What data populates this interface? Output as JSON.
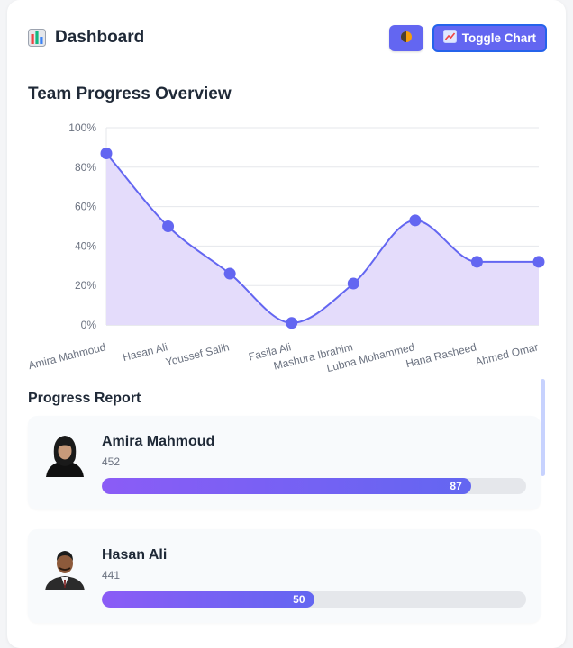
{
  "header": {
    "title": "Dashboard",
    "logo_icon": "bar-chart-icon",
    "theme_icon": "contrast-icon",
    "toggle_label": "Toggle Chart",
    "toggle_icon": "line-chart-icon"
  },
  "chart": {
    "title": "Team Progress Overview",
    "accent": "#6366f1",
    "fill": "#e4dcfb"
  },
  "chart_data": {
    "type": "area",
    "categories": [
      "Amira Mahmoud",
      "Hasan Ali",
      "Youssef Salih",
      "Fasila Ali",
      "Mashura Ibrahim",
      "Lubna Mohammed",
      "Hana Rasheed",
      "Ahmed Omar"
    ],
    "series": [
      {
        "values": [
          87,
          50,
          26,
          1,
          21,
          53,
          32,
          32
        ]
      }
    ],
    "yticks": [
      "0%",
      "20%",
      "40%",
      "60%",
      "80%",
      "100%"
    ],
    "ylim": [
      0,
      100
    ],
    "grid": true
  },
  "report": {
    "title": "Progress Report",
    "items": [
      {
        "name": "Amira Mahmoud",
        "sub": "452",
        "progress": 87,
        "progress_label": "87"
      },
      {
        "name": "Hasan Ali",
        "sub": "441",
        "progress": 50,
        "progress_label": "50"
      }
    ]
  }
}
